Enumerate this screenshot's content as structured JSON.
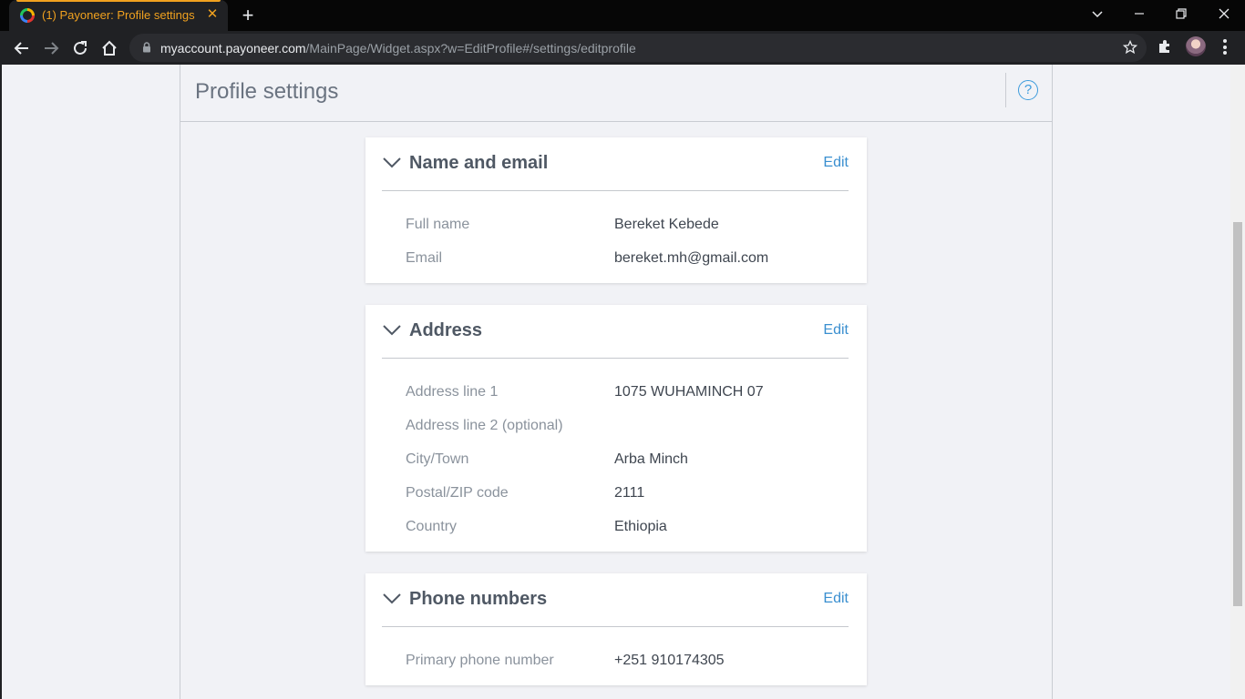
{
  "browser": {
    "tab_title": "(1) Payoneer: Profile settings",
    "tab_close": "✕",
    "new_tab": "+",
    "url_host": "myaccount.payoneer.com",
    "url_path": "/MainPage/Widget.aspx?w=EditProfile#/settings/editprofile",
    "accent_color": "#f0a11f"
  },
  "page": {
    "title": "Profile settings",
    "help_label": "?"
  },
  "sections": {
    "name_email": {
      "title": "Name and email",
      "edit_label": "Edit",
      "rows": [
        {
          "label": "Full name",
          "value": "Bereket Kebede"
        },
        {
          "label": "Email",
          "value": "bereket.mh@gmail.com"
        }
      ]
    },
    "address": {
      "title": "Address",
      "edit_label": "Edit",
      "rows": [
        {
          "label": "Address line 1",
          "value": "1075 WUHAMINCH 07"
        },
        {
          "label": "Address line 2 (optional)",
          "value": ""
        },
        {
          "label": "City/Town",
          "value": "Arba Minch"
        },
        {
          "label": "Postal/ZIP code",
          "value": "2111"
        },
        {
          "label": "Country",
          "value": "Ethiopia"
        }
      ]
    },
    "phone": {
      "title": "Phone numbers",
      "edit_label": "Edit",
      "rows": [
        {
          "label": "Primary phone number",
          "value": "+251 910174305"
        }
      ]
    }
  },
  "icons": [
    "chevron-down-icon",
    "help-icon",
    "lock-icon",
    "star-icon",
    "extensions-icon",
    "back-icon",
    "forward-icon",
    "reload-icon",
    "home-icon"
  ],
  "colors": {
    "link": "#3a8fd0",
    "title_text": "#4f5864",
    "label_text": "#8a929c"
  }
}
